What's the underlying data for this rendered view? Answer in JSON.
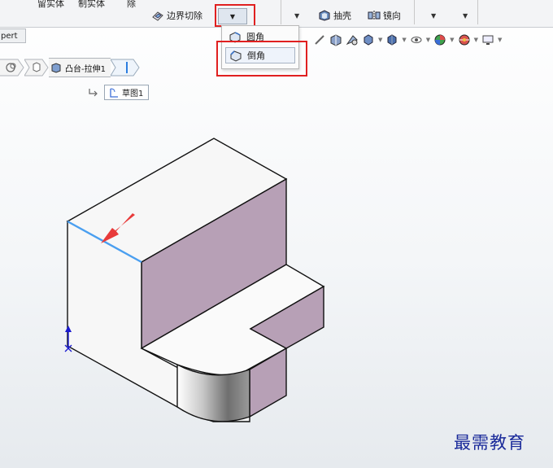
{
  "ribbon": {
    "keep_body_label": "留实体",
    "make_body_label": "制实体",
    "remove_label": "除",
    "boundary_cut_label": "边界切除",
    "shell_label": "抽壳",
    "mirror_label": "镜向"
  },
  "dropdown_menu": {
    "items": [
      {
        "label": "圆角",
        "icon": "fillet-icon",
        "selected": false
      },
      {
        "label": "倒角",
        "icon": "chamfer-icon",
        "selected": true
      }
    ]
  },
  "panel_tab": {
    "label": "pert"
  },
  "breadcrumb": {
    "feature_label": "凸台-拉伸1",
    "sketch_label": "草图1"
  },
  "colors": {
    "highlight": "#e02020",
    "edge_selected": "#4a9ff0",
    "face_purple": "#b7a0b6",
    "face_white": "#f7f7f7"
  },
  "watermark": "最需教育"
}
